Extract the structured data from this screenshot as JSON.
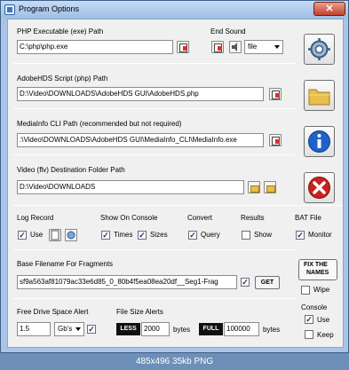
{
  "window": {
    "title": "Program Options",
    "close_symbol": "✕"
  },
  "php": {
    "label": "PHP Executable (exe) Path",
    "value": "C:\\php\\php.exe"
  },
  "end_sound": {
    "label": "End Sound",
    "option": "file"
  },
  "adobehds": {
    "label": "AdobeHDS Script (php) Path",
    "value": "D:\\Video\\DOWNLOADS\\AdobeHDS GUI\\AdobeHDS.php"
  },
  "mediainfo": {
    "label": "MediaInfo CLI Path  (recommended but not required)",
    "value": ":\\Video\\DOWNLOADS\\AdobeHDS GUI\\MediaInfo_CLI\\MediaInfo.exe"
  },
  "destination": {
    "label": "Video (flv) Destination Folder Path",
    "value": "D:\\Video\\DOWNLOADS"
  },
  "log_record": {
    "label": "Log Record",
    "use_label": "Use",
    "use_checked": true
  },
  "show_on_console": {
    "label": "Show On Console",
    "times_label": "Times",
    "times_checked": true,
    "sizes_label": "Sizes",
    "sizes_checked": true
  },
  "convert": {
    "label": "Convert",
    "query_label": "Query",
    "query_checked": true
  },
  "results": {
    "label": "Results",
    "show_label": "Show",
    "show_checked": false
  },
  "bat_file": {
    "label": "BAT File",
    "monitor_label": "Monitor",
    "monitor_checked": true
  },
  "base_filename": {
    "label": "Base Filename For Fragments",
    "value": "sf9a563af81079ac33e6d85_0_80b4f5ea08ea20df__Seg1-Frag",
    "checked": true,
    "get_label": "GET"
  },
  "fix_names": {
    "label_line1": "FIX THE",
    "label_line2": "NAMES",
    "wipe_label": "Wipe",
    "wipe_checked": false
  },
  "free_drive": {
    "label": "Free Drive Space Alert",
    "value": "1.5",
    "unit": "Gb's",
    "checked": true
  },
  "file_size": {
    "label": "File Size Alerts",
    "less_label": "LESS",
    "less_value": "2000",
    "less_unit": "bytes",
    "full_label": "FULL",
    "full_value": "100000",
    "full_unit": "bytes"
  },
  "console": {
    "label": "Console",
    "use_label": "Use",
    "use_checked": true,
    "keep_label": "Keep",
    "keep_checked": false
  },
  "status_bar": {
    "text": "485x496  35kb  PNG"
  },
  "icons": {
    "settings": "gear-icon",
    "folder": "folder-icon",
    "info": "info-icon",
    "cancel": "close-icon"
  },
  "colors": {
    "title_bar": "#a9c4e6",
    "client": "#f0f0f0",
    "info_blue": "#1f62c8",
    "cancel_red": "#c8221d",
    "folder_gold": "#e7bf4a"
  }
}
